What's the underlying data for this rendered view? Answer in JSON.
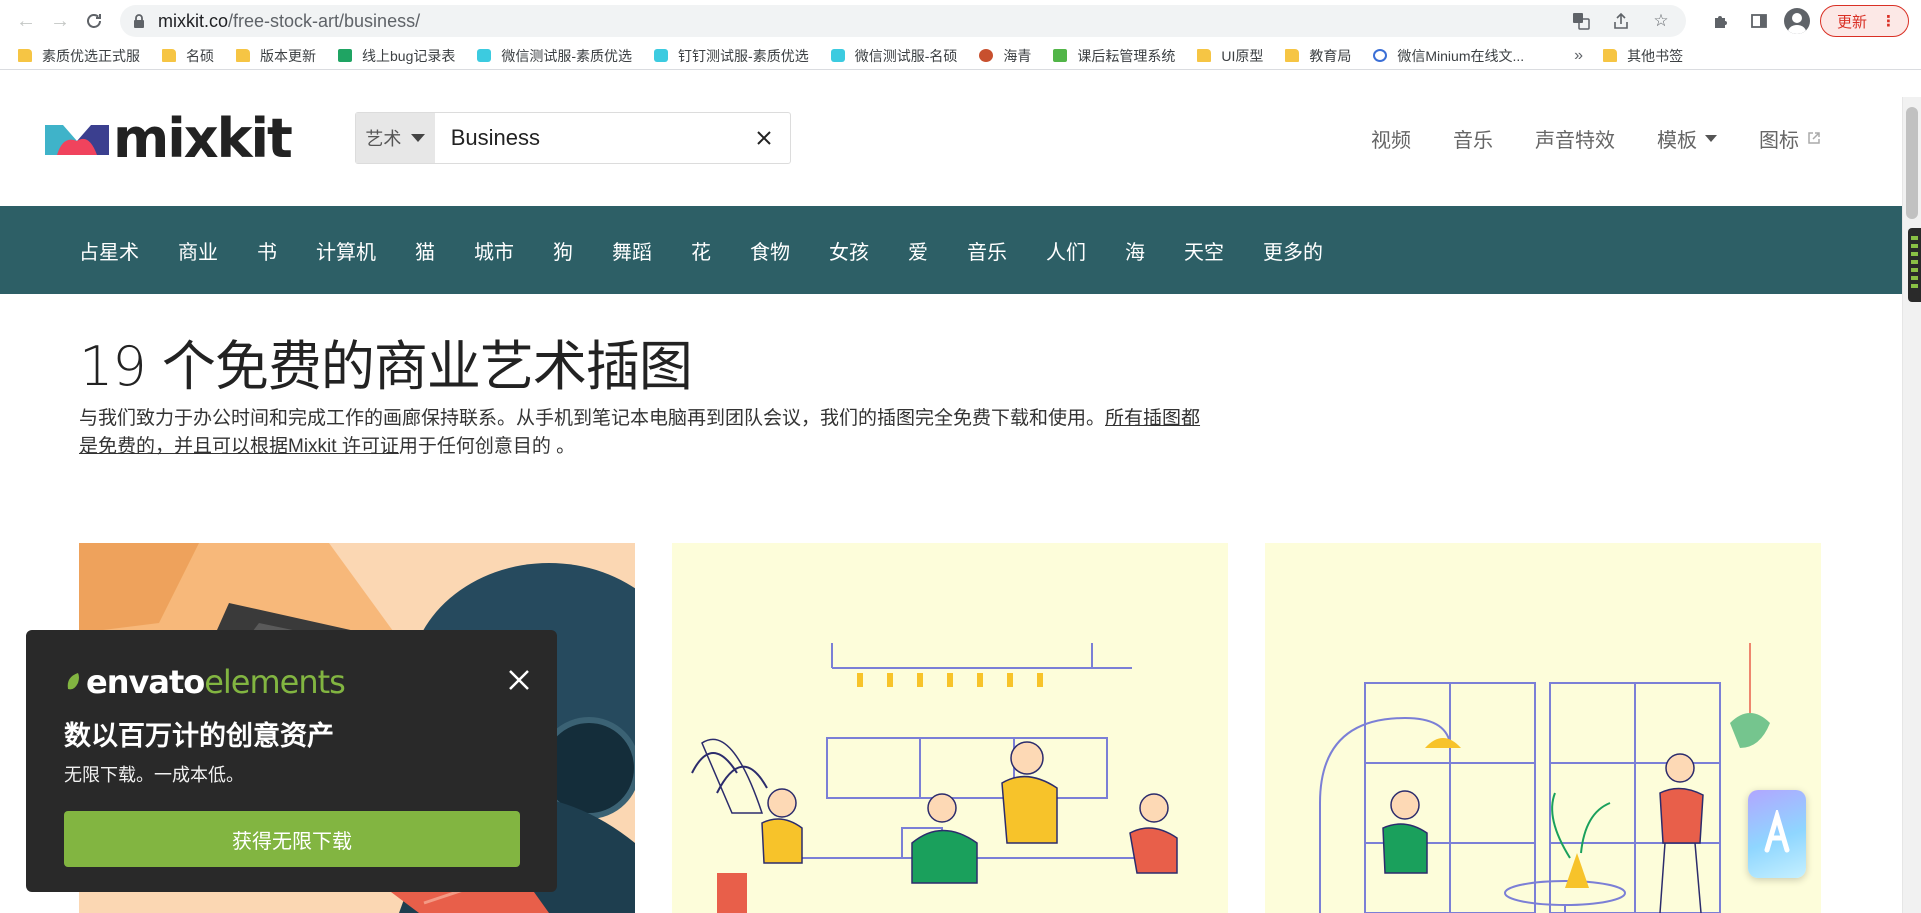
{
  "browser": {
    "url_host": "mixkit.co",
    "url_path": "/free-stock-art/business/",
    "update_label": "更新",
    "bookmarks": [
      {
        "label": "素质优选正式服",
        "icon": "folder"
      },
      {
        "label": "名硕",
        "icon": "folder"
      },
      {
        "label": "版本更新",
        "icon": "folder"
      },
      {
        "label": "线上bug记录表",
        "icon": "sheet"
      },
      {
        "label": "微信测试服-素质优选",
        "icon": "u"
      },
      {
        "label": "钉钉测试服-素质优选",
        "icon": "u"
      },
      {
        "label": "微信测试服-名硕",
        "icon": "u"
      },
      {
        "label": "海青",
        "icon": "circle"
      },
      {
        "label": "课后耘管理系统",
        "icon": "green"
      },
      {
        "label": "UI原型",
        "icon": "folder"
      },
      {
        "label": "教育局",
        "icon": "folder"
      },
      {
        "label": "微信Minium在线文...",
        "icon": "ring"
      }
    ],
    "bookmarks_overflow": "»",
    "other_bookmarks": "其他书签"
  },
  "site": {
    "logo_text": "mixkit",
    "search": {
      "type_label": "艺术",
      "value": "Business"
    },
    "topnav": {
      "video": "视频",
      "music": "音乐",
      "sfx": "声音特效",
      "templates": "模板",
      "icons": "图标"
    },
    "categories": [
      "占星术",
      "商业",
      "书",
      "计算机",
      "猫",
      "城市",
      "狗",
      "舞蹈",
      "花",
      "食物",
      "女孩",
      "爱",
      "音乐",
      "人们",
      "海",
      "天空",
      "更多的"
    ]
  },
  "content": {
    "title": "19 个免费的商业艺术插图",
    "intro_text": "与我们致力于办公时间和完成工作的画廊保持联系。从手机到笔记本电脑再到团队会议，我们的插图完全免费下载和使用。",
    "intro_link": "所有插图都是免费的，并且可以根据Mixkit 许可证",
    "intro_tail": "用于任何创意目的 。"
  },
  "promo": {
    "brand_bold": "envato",
    "brand_light": "elements",
    "headline": "数以百万计的创意资产",
    "sub": "无限下载。一成本低。",
    "cta": "获得无限下载"
  },
  "colors": {
    "category_bar": "#2d5f66",
    "promo_bg": "#292929",
    "promo_green": "#82b541",
    "card_cream": "#fdfdda"
  }
}
